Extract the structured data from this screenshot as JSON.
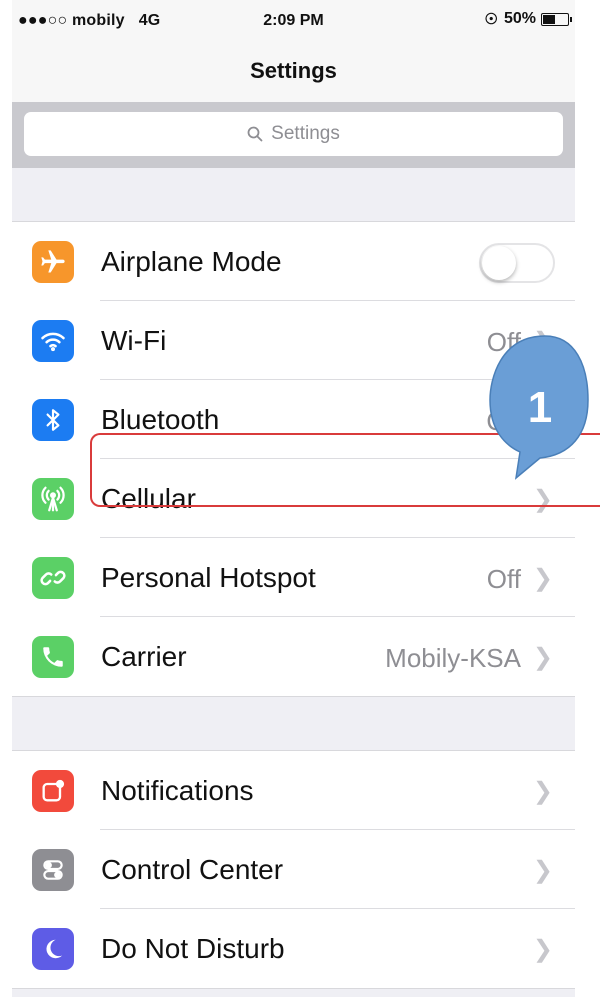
{
  "status_bar": {
    "signal": "●●●○○",
    "carrier": "mobily",
    "network": "4G",
    "time": "2:09 PM",
    "battery": "50%",
    "battery_level": 0.5
  },
  "nav": {
    "title": "Settings"
  },
  "search": {
    "placeholder": "Settings",
    "icon": "search-icon"
  },
  "groups": [
    {
      "rows": [
        {
          "label": "Airplane Mode",
          "icon": "airplane-icon",
          "icon_color": "#f7962b",
          "accessory": "toggle",
          "toggle_on": false
        },
        {
          "label": "Wi-Fi",
          "icon": "wifi-icon",
          "icon_color": "#1c7cf2",
          "value": "Off"
        },
        {
          "label": "Bluetooth",
          "icon": "bluetooth-icon",
          "icon_color": "#1c7cf2",
          "value": "On"
        },
        {
          "label": "Cellular",
          "icon": "cellular-icon",
          "icon_color": "#5bd066"
        },
        {
          "label": "Personal Hotspot",
          "icon": "hotspot-icon",
          "icon_color": "#5bd066",
          "value": "Off"
        },
        {
          "label": "Carrier",
          "icon": "phone-icon",
          "icon_color": "#5bd066",
          "value": "Mobily-KSA"
        }
      ]
    },
    {
      "rows": [
        {
          "label": "Notifications",
          "icon": "notifications-icon",
          "icon_color": "#f24a3c"
        },
        {
          "label": "Control Center",
          "icon": "control-center-icon",
          "icon_color": "#8e8e93"
        },
        {
          "label": "Do Not Disturb",
          "icon": "moon-icon",
          "icon_color": "#5e5ce6"
        }
      ]
    }
  ],
  "annotation": {
    "step_number": "1",
    "bubble_color": "#6a9ed6",
    "highlight_color": "#d93b3b"
  }
}
